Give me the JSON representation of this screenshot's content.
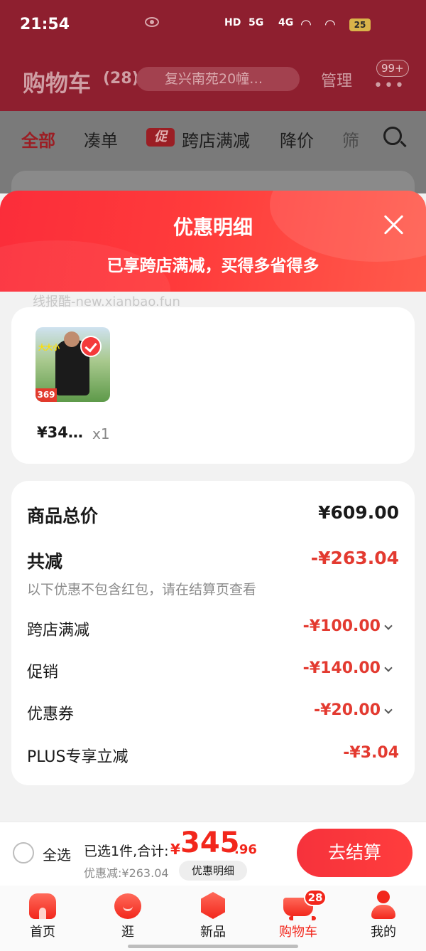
{
  "status_bar": {
    "time": "21:54",
    "hd": "HD",
    "signal1": "5G",
    "signal2": "4G",
    "battery": "25"
  },
  "cart_header": {
    "title": "购物车",
    "count": "(28)",
    "address": "复兴南苑20幢…",
    "manage": "管理",
    "more_icon": "•••",
    "badge": "99+"
  },
  "filters": {
    "all": "全部",
    "combine": "凑单",
    "promo_tag": "促",
    "cross_store": "跨店满减",
    "price_drop": "降价",
    "filter": "筛"
  },
  "sheet": {
    "title": "优惠明细",
    "subtitle": "已享跨店满减，买得多省得多",
    "watermark": "线报酷-new.xianbao.fun"
  },
  "product": {
    "thumb_tag": "大大小",
    "thumb_price": "369",
    "price": "¥34…",
    "qty": "x1"
  },
  "detail": {
    "total_label": "商品总价",
    "total_value": "¥609.00",
    "reduce_label": "共减",
    "reduce_value": "-¥263.04",
    "note": "以下优惠不包含红包，请在结算页查看",
    "items": [
      {
        "label": "跨店满减",
        "value": "-¥100.00"
      },
      {
        "label": "促销",
        "value": "-¥140.00"
      },
      {
        "label": "优惠券",
        "value": "-¥20.00"
      },
      {
        "label": "PLUS专享立减",
        "value": "-¥3.04"
      }
    ]
  },
  "checkout": {
    "select_all": "全选",
    "selected": "已选1件,合计:",
    "currency": "¥",
    "total_int": "345",
    "total_dec": ".96",
    "saved": "优惠减:¥263.04",
    "detail_button": "优惠明细",
    "checkout_button": "去结算"
  },
  "tabs": [
    {
      "label": "首页",
      "icon": "home-icon"
    },
    {
      "label": "逛",
      "icon": "stroll-icon"
    },
    {
      "label": "新品",
      "icon": "new-icon"
    },
    {
      "label": "购物车",
      "icon": "cart-icon",
      "badge": "28"
    },
    {
      "label": "我的",
      "icon": "me-icon"
    }
  ],
  "colors": {
    "accent": "#f2271c",
    "header_gradient_start": "#fb2d3a",
    "header_gradient_end": "#ff5a4b",
    "discount_text": "#e33a30"
  }
}
